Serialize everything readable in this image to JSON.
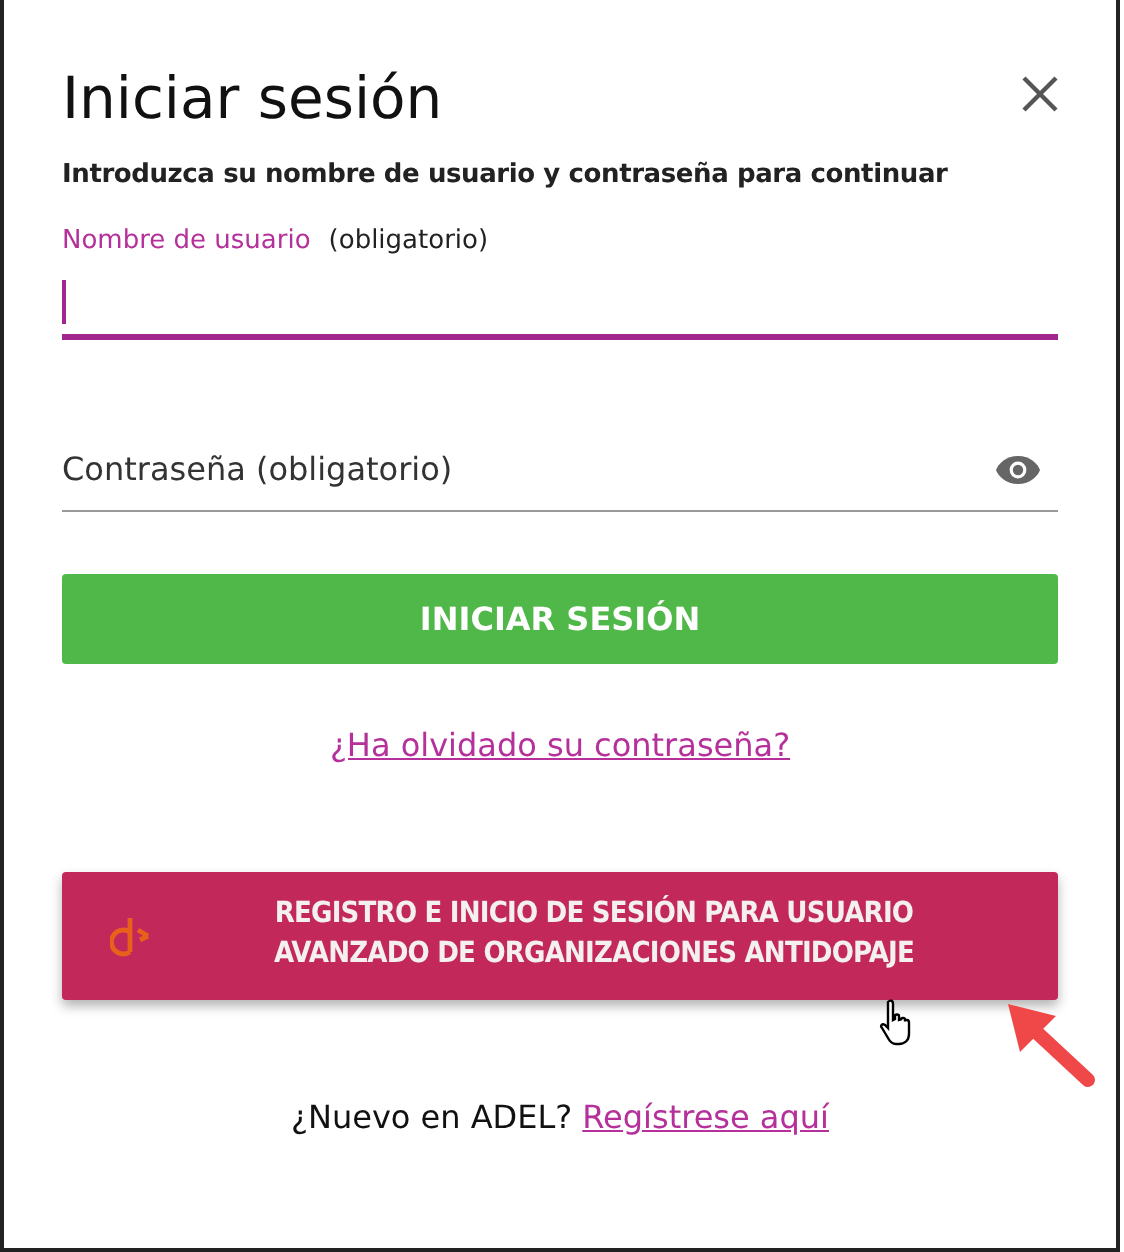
{
  "dialog": {
    "title": "Iniciar sesión",
    "subtitle": "Introduzca su nombre de usuario y contraseña para continuar"
  },
  "username": {
    "label": "Nombre de usuario",
    "note": "(obligatorio)",
    "focused": true
  },
  "password": {
    "placeholder": "Contraseña (obligatorio)"
  },
  "login_button": "INICIAR SESIÓN",
  "forgot_link": "¿Ha olvidado su contraseña?",
  "advanced_button": "REGISTRO E INICIO DE SESIÓN PARA USUARIO AVANZADO DE ORGANIZACIONES ANTIDOPAJE",
  "footer": {
    "text": "¿Nuevo en ADEL?",
    "link": "Regístrese aquí"
  }
}
